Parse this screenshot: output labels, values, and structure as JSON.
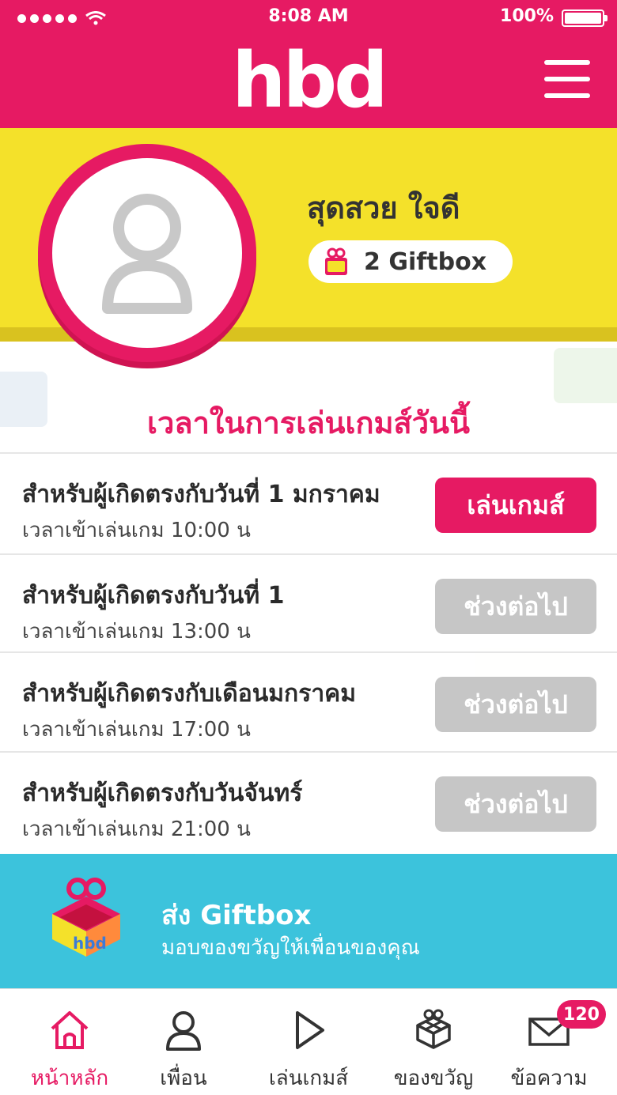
{
  "status_bar": {
    "time": "8:08 AM",
    "battery": "100%"
  },
  "header": {
    "logo": "hbd",
    "menu_icon": "hamburger-menu-icon"
  },
  "profile": {
    "name": "สุดสวย ใจดี",
    "giftbox_count": "2 Giftbox",
    "avatar_icon": "user-placeholder-icon"
  },
  "schedule": {
    "title": "เวลาในการเล่นเกมส์วันนี้",
    "rows": [
      {
        "title": "สำหรับผู้เกิดตรงกับวันที่ 1 มกราคม",
        "time": "เวลาเข้าเล่นเกม 10:00 น",
        "button": "เล่นเกมส์",
        "state": "active"
      },
      {
        "title": "สำหรับผู้เกิดตรงกับวันที่ 1",
        "time": "เวลาเข้าเล่นเกม 13:00 น",
        "button": "ช่วงต่อไป",
        "state": "disabled"
      },
      {
        "title": "สำหรับผู้เกิดตรงกับเดือนมกราคม",
        "time": "เวลาเข้าเล่นเกม 17:00 น",
        "button": "ช่วงต่อไป",
        "state": "disabled"
      },
      {
        "title": "สำหรับผู้เกิดตรงกับวันจันทร์",
        "time": "เวลาเข้าเล่นเกม 21:00 น",
        "button": "ช่วงต่อไป",
        "state": "disabled"
      }
    ]
  },
  "gift_banner": {
    "title": "ส่ง Giftbox",
    "subtitle": "มอบของขวัญให้เพื่อนของคุณ"
  },
  "bottom_nav": {
    "items": [
      {
        "label": "หน้าหลัก",
        "icon": "home-icon"
      },
      {
        "label": "เพื่อน",
        "icon": "friend-icon"
      },
      {
        "label": "เล่นเกมส์",
        "icon": "play-icon"
      },
      {
        "label": "ของขวัญ",
        "icon": "gift-icon"
      },
      {
        "label": "ข้อความ",
        "icon": "message-icon",
        "badge": "120"
      }
    ]
  },
  "colors": {
    "brand_pink": "#e61a63",
    "profile_yellow": "#f4e12a",
    "banner_cyan": "#3cc3dc",
    "disabled_gray": "#c6c6c6"
  }
}
